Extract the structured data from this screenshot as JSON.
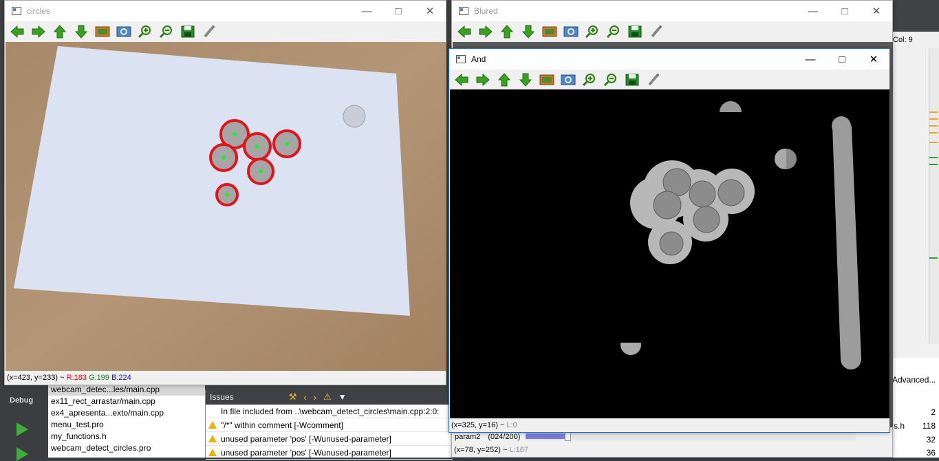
{
  "ide": {
    "debug_label": "Debug",
    "col_label": "Col: 9",
    "advanced_label": "Advanced...",
    "files": [
      "webcam_detec...les/main.cpp",
      "ex11_rect_arrastar/main.cpp",
      "ex4_apresenta...exto/main.cpp",
      "menu_test.pro",
      "my_functions.h",
      "webcam_detect_circles.pro"
    ],
    "issues_title": "Issues",
    "issues": [
      "In file included from ..\\webcam_detect_circles\\main.cpp:2:0:",
      "\"/*\" within comment [-Wcomment]",
      "unused parameter 'pos' [-Wunused-parameter]",
      "unused parameter 'pos' [-Wunused-parameter]"
    ],
    "right_nums": [
      "2",
      "118",
      "32",
      "36"
    ],
    "right_file": "s.h"
  },
  "windows": {
    "circles": {
      "title": "circles",
      "status_coords": "(x=423, y=233) ~ ",
      "status_r": "R:183",
      "status_g": "G:199",
      "status_b": "B:224"
    },
    "blured": {
      "title": "Blured",
      "param_label": "param2",
      "param_value": "(024/200)",
      "param_level": 0.12,
      "status_coords": "(x=78, y=252) ~ ",
      "status_l": "L:167"
    },
    "and": {
      "title": "And",
      "status_coords": "(x=325, y=16) ~ ",
      "status_l": "L:0"
    }
  },
  "toolbar_icons": [
    "arrow-left-icon",
    "arrow-right-icon",
    "arrow-up-icon",
    "arrow-down-icon",
    "image-icon",
    "zoom-fit-icon",
    "zoom-in-icon",
    "zoom-out-icon",
    "save-icon",
    "properties-icon"
  ],
  "colors": {
    "arrow": "#3aa21f",
    "circle": "#e0141a",
    "center": "#27e83a",
    "status_r": "#d01010",
    "status_g": "#108010",
    "status_b": "#1010d0"
  }
}
